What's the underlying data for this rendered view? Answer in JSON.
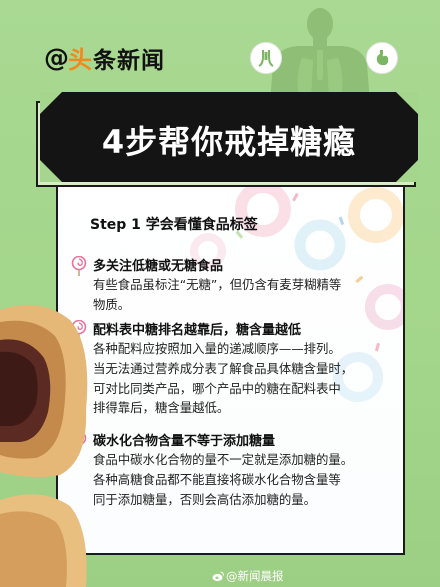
{
  "brand": {
    "at": "@",
    "mark": "头",
    "name": "条新闻"
  },
  "header": {
    "title": "4步帮你戒掉糖瘾"
  },
  "card": {
    "step_title": "Step 1  学会看懂食品标签",
    "items": [
      {
        "heading": "多关注低糖或无糖食品",
        "lines": [
          "有些食品虽标注“无糖”，但仍含有麦芽糊精等",
          "物质。"
        ]
      },
      {
        "heading": "配料表中糖排名越靠后，糖含量越低",
        "lines": [
          "各种配料应按照加入量的递减顺序——排列。",
          "当无法通过营养成分表了解食品具体糖含量时，",
          "可对比同类产品，哪个产品中的糖在配料表中",
          "排得靠后，糖含量越低。"
        ]
      },
      {
        "heading": "碳水化合物含量不等于添加糖量",
        "lines": [
          "食品中碳水化合物的量不一定就是添加糖的量。",
          "各种高糖食品都不能直接将碳水化合物含量等",
          "同于添加糖量，否则会高估添加糖的量。"
        ]
      }
    ]
  },
  "footer": {
    "watermark": "@新闻晨报"
  },
  "icons": {
    "brand": "toutiao-logo-icon",
    "silhouette": "human-body-organs-icon",
    "throat": "throat-icon",
    "stomach": "stomach-icon",
    "lollipop": "lollipop-icon",
    "weibo": "weibo-logo-icon"
  },
  "colors": {
    "background": "#a6d68e",
    "banner": "#141414",
    "card": "#ffffff",
    "accent_orange": "#f08a1e",
    "lollipop_pink": "#e7739a"
  }
}
